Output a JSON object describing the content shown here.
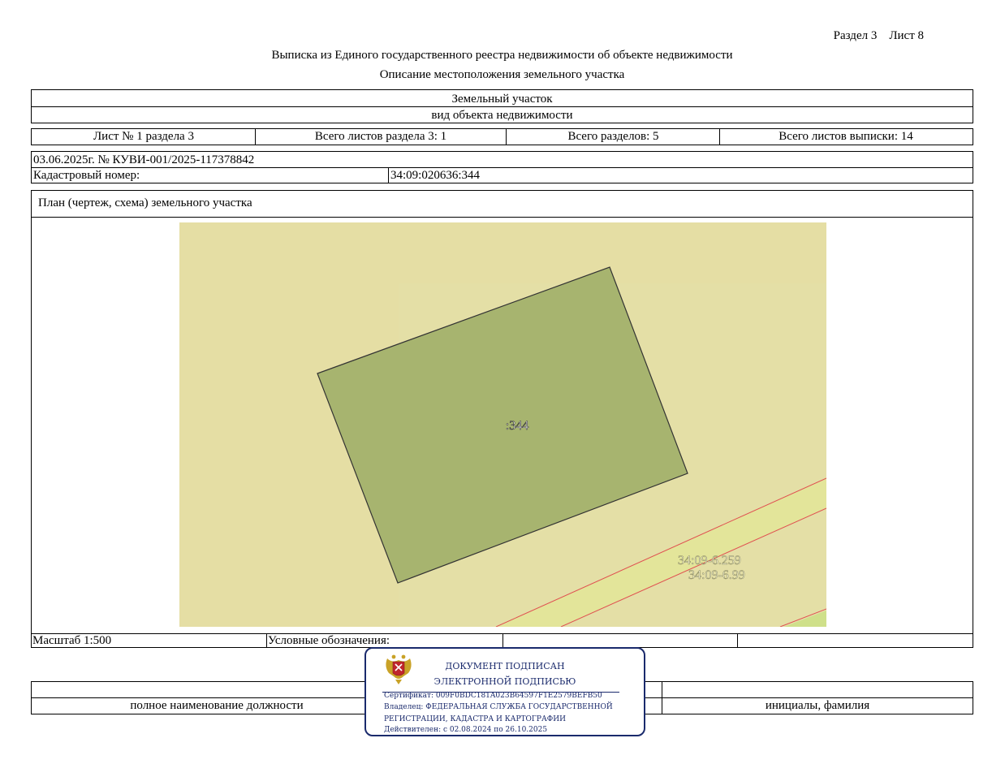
{
  "header": {
    "section_sheet": "Раздел 3    Лист 8",
    "title": "Выписка из Единого государственного реестра недвижимости об объекте недвижимости",
    "subtitle": "Описание местоположения земельного участка"
  },
  "object": {
    "type": "Земельный участок",
    "type_caption": "вид объекта недвижимости"
  },
  "sheets": {
    "sheet_no": "Лист № 1 раздела 3",
    "total_section_sheets": "Всего листов раздела 3: 1",
    "total_sections": "Всего разделов: 5",
    "total_extract_sheets": "Всего листов выписки: 14"
  },
  "record": {
    "date_number": "03.06.2025г. № КУВИ-001/2025-117378842",
    "cadastral_label": "Кадастровый номер:",
    "cadastral_value": "34:09:020636:344"
  },
  "plan": {
    "heading": "План (чертеж, схема) земельного участка",
    "parcel_label": ":344",
    "zone_label_1": "34:09-6.259",
    "zone_label_2": "34:09-6.99",
    "colors": {
      "background": "#e5dea4",
      "parcel": "#a7b46f",
      "strip": "#e3e59a",
      "red_line": "#e05050"
    }
  },
  "footer": {
    "scale": "Масштаб 1:500",
    "legend_label": "Условные обозначения:",
    "position_caption": "полное наименование должности",
    "name_caption": "инициалы, фамилия"
  },
  "stamp": {
    "line1": "ДОКУМЕНТ ПОДПИСАН",
    "line2": "ЭЛЕКТРОННОЙ ПОДПИСЬЮ",
    "certificate": "Сертификат: 009F0BDC181A023B64597F1E2579BEFB50",
    "owner_1": "Владелец: ФЕДЕРАЛЬНАЯ СЛУЖБА ГОСУДАРСТВЕННОЙ",
    "owner_2": "РЕГИСТРАЦИИ, КАДАСТРА И КАРТОГРАФИИ",
    "valid": "Действителен: с 02.08.2024 по 26.10.2025",
    "emblem_icon": "coat-of-arms-icon",
    "color": "#1a2a6c"
  }
}
